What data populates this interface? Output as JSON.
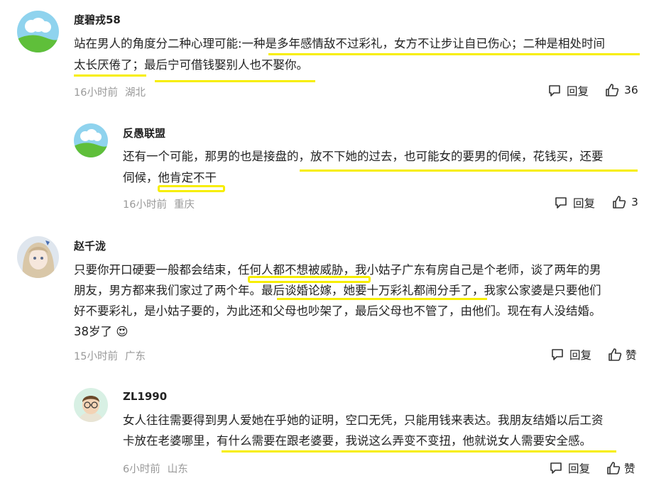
{
  "comments": [
    {
      "username": "度碧戎58",
      "lines": [
        "站在男人的角度分二种心理可能:一种是多年感情敌不过彩礼，女方不让步让自已伤心；二种是相处时间",
        "太长厌倦了；最后宁可借钱娶别人也不娶你。"
      ],
      "time": "16小时前",
      "location": "湖北",
      "reply_label": "回复",
      "like_count": "36"
    },
    {
      "username": "反愚联盟",
      "lines": [
        "还有一个可能，那男的也是接盘的，放不下她的过去，也可能女的要男的伺候，花钱买，还要",
        "伺候，他肯定不干"
      ],
      "time": "16小时前",
      "location": "重庆",
      "reply_label": "回复",
      "like_count": "3"
    },
    {
      "username": "赵千泷",
      "lines": [
        "只要你开口硬要一般都会结束，任何人都不想被威胁，我小姑子广东有房自己是个老师，谈了两年的男",
        "朋友，男方都来我们家过了两个年。最后谈婚论嫁，她要十万彩礼都闹分手了，我家公家婆是只要他们",
        "好不要彩礼，是小姑子要的，为此还和父母也吵架了，最后父母也不管了，由他们。现在有人没结婚。",
        "38岁了 😍"
      ],
      "time": "15小时前",
      "location": "广东",
      "reply_label": "回复",
      "like_count": "赞"
    },
    {
      "username": "ZL1990",
      "lines": [
        "女人往往需要得到男人爱她在乎她的证明，空口无凭，只能用钱来表达。我朋友结婚以后工资",
        "卡放在老婆哪里，有什么需要在跟老婆要，我说这么弄变不变扭，他就说女人需要安全感。"
      ],
      "time": "6小时前",
      "location": "山东",
      "reply_label": "回复",
      "like_count": "赞"
    }
  ],
  "highlight_color": "#f7ee00",
  "icons": [
    "comment-icon",
    "thumbs-up-icon"
  ]
}
